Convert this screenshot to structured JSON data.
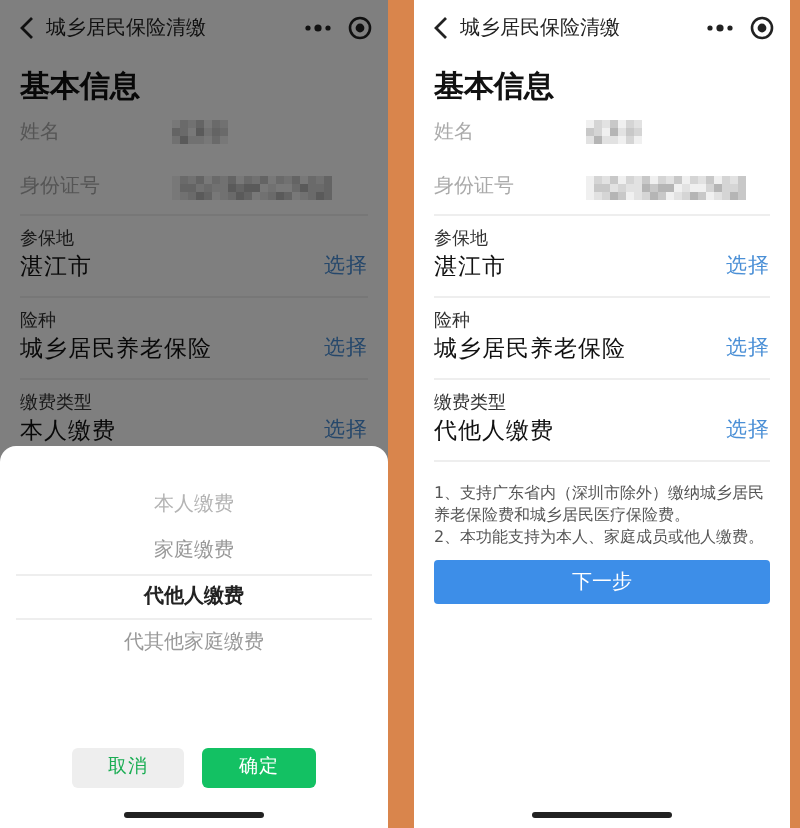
{
  "screens": [
    {
      "dimmed": true,
      "nav": {
        "title": "城乡居民保险清缴"
      },
      "heading": "基本信息",
      "identity": [
        {
          "label": "姓名"
        },
        {
          "label": "身份证号"
        }
      ],
      "fields": [
        {
          "label": "参保地",
          "value": "湛江市",
          "action": "选择"
        },
        {
          "label": "险种",
          "value": "城乡居民养老保险",
          "action": "选择"
        },
        {
          "label": "缴费类型",
          "value": "本人缴费",
          "action": "选择"
        }
      ],
      "picker": {
        "options": [
          {
            "label": "本人缴费",
            "selected": false
          },
          {
            "label": "家庭缴费",
            "selected": false
          },
          {
            "label": "代他人缴费",
            "selected": true
          },
          {
            "label": "代其他家庭缴费",
            "selected": false
          }
        ],
        "cancel": "取消",
        "confirm": "确定"
      }
    },
    {
      "dimmed": false,
      "nav": {
        "title": "城乡居民保险清缴"
      },
      "heading": "基本信息",
      "identity": [
        {
          "label": "姓名"
        },
        {
          "label": "身份证号"
        }
      ],
      "fields": [
        {
          "label": "参保地",
          "value": "湛江市",
          "action": "选择"
        },
        {
          "label": "险种",
          "value": "城乡居民养老保险",
          "action": "选择"
        },
        {
          "label": "缴费类型",
          "value": "代他人缴费",
          "action": "选择"
        }
      ],
      "notes": [
        "1、支持广东省内（深圳市除外）缴纳城乡居民养老保险费和城乡居民医疗保险费。",
        "2、本功能支持为本人、家庭成员或他人缴费。"
      ],
      "next_button": "下一步"
    }
  ]
}
